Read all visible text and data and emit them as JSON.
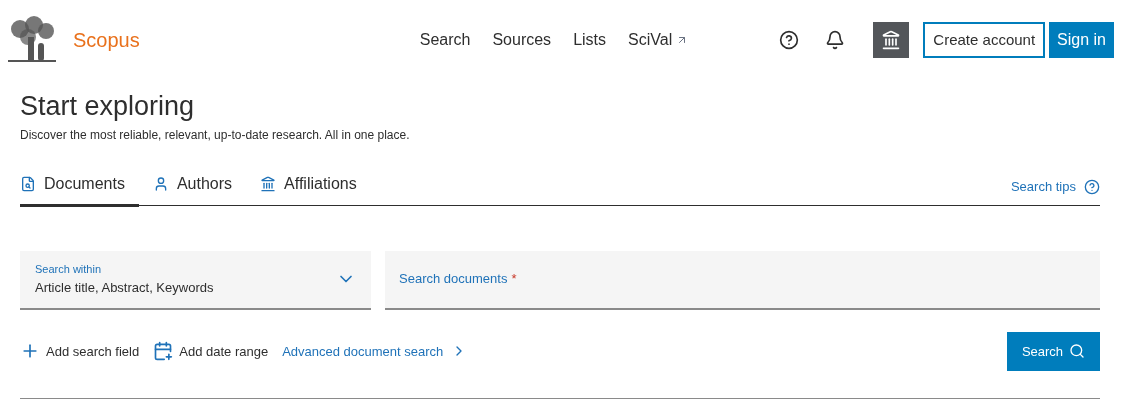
{
  "header": {
    "brand": "Scopus",
    "nav": [
      {
        "label": "Search",
        "external": false
      },
      {
        "label": "Sources",
        "external": false
      },
      {
        "label": "Lists",
        "external": false
      },
      {
        "label": "SciVal",
        "external": true
      }
    ],
    "buttons": [
      {
        "label": "Create account",
        "kind": "outline"
      },
      {
        "label": "Sign in",
        "kind": "primary"
      }
    ]
  },
  "hero": {
    "title": "Start exploring",
    "subtitle": "Discover the most reliable, relevant, up-to-date research. All in one place."
  },
  "tabs": [
    {
      "label": "Documents",
      "kind": "document",
      "selected": true
    },
    {
      "label": "Authors",
      "kind": "person",
      "selected": false
    },
    {
      "label": "Affiliations",
      "kind": "building",
      "selected": false
    }
  ],
  "search_tips": "Search tips",
  "search_within": {
    "label": "Search within",
    "value": "Article title, Abstract, Keywords"
  },
  "search_field": {
    "placeholder": "Search documents",
    "required_mark": "*"
  },
  "actions": [
    {
      "label": "Add search field",
      "kind": "plus"
    },
    {
      "label": "Add date range",
      "kind": "date"
    },
    {
      "label": "Advanced document search",
      "kind": "link"
    }
  ],
  "search_button": "Search"
}
